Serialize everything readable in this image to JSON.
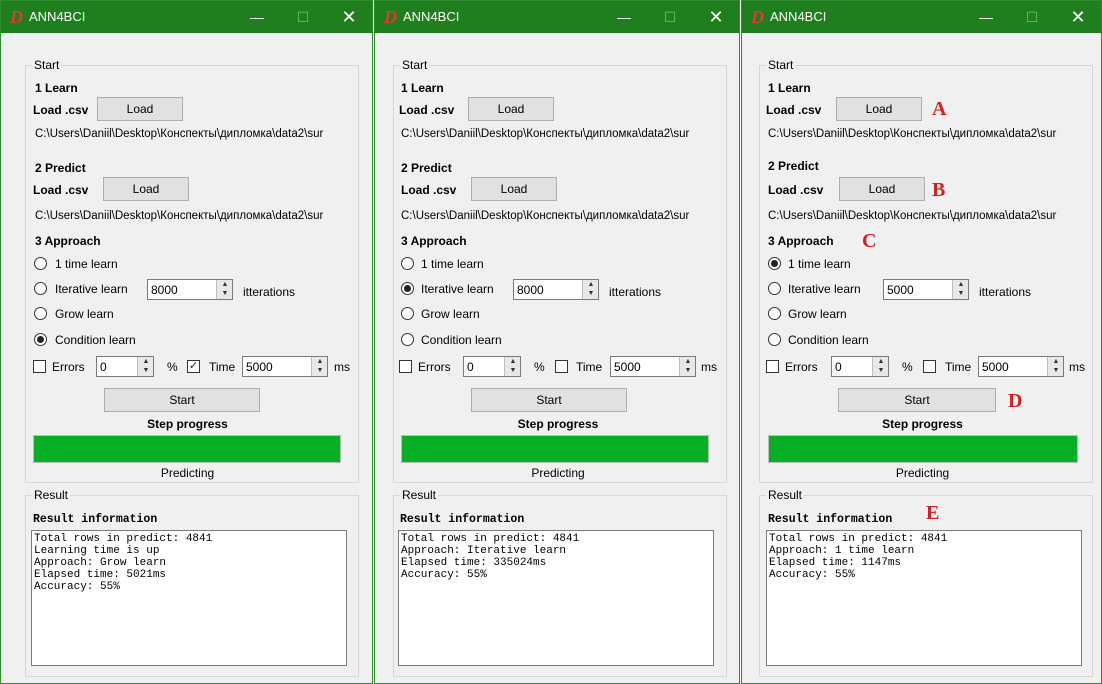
{
  "windows": [
    {
      "app_title": "ANN4BCI",
      "start_label": "Start",
      "learn_heading": "1 Learn",
      "learn_load_label": "Load .csv",
      "learn_load_button": "Load",
      "learn_path": "C:\\Users\\Daniil\\Desktop\\Конспекты\\дипломка\\data2\\sur",
      "predict_heading": "2 Predict",
      "predict_load_label": "Load .csv",
      "predict_load_button": "Load",
      "predict_path": "C:\\Users\\Daniil\\Desktop\\Конспекты\\дипломка\\data2\\sur",
      "approach_heading": "3 Approach",
      "radio_one_time": "1 time learn",
      "radio_iterative": "Iterative learn",
      "iterations_value": "8000",
      "iterations_label": "itterations",
      "radio_grow": "Grow learn",
      "radio_condition": "Condition learn",
      "selected_approach": "condition",
      "errors_label": "Errors",
      "errors_checked": false,
      "errors_value": "0",
      "percent_label": "%",
      "time_label": "Time",
      "time_checked": true,
      "time_value": "5000",
      "ms_label": "ms",
      "start_button": "Start",
      "step_progress_label": "Step progress",
      "progress_percent": 100,
      "progress_status": "Predicting",
      "result_label": "Result",
      "result_heading": "Result information",
      "result_lines": [
        "Total rows in predict: 4841",
        "Learning time is up",
        "Approach: Grow learn",
        "Elapsed time: 5021ms",
        "Accuracy: 55%"
      ]
    },
    {
      "app_title": "ANN4BCI",
      "start_label": "Start",
      "learn_heading": "1 Learn",
      "learn_load_label": "Load .csv",
      "learn_load_button": "Load",
      "learn_path": "C:\\Users\\Daniil\\Desktop\\Конспекты\\дипломка\\data2\\sur",
      "predict_heading": "2 Predict",
      "predict_load_label": "Load .csv",
      "predict_load_button": "Load",
      "predict_path": "C:\\Users\\Daniil\\Desktop\\Конспекты\\дипломка\\data2\\sur",
      "approach_heading": "3 Approach",
      "radio_one_time": "1 time learn",
      "radio_iterative": "Iterative learn",
      "iterations_value": "8000",
      "iterations_label": "itterations",
      "radio_grow": "Grow learn",
      "radio_condition": "Condition learn",
      "selected_approach": "iterative",
      "errors_label": "Errors",
      "errors_checked": false,
      "errors_value": "0",
      "percent_label": "%",
      "time_label": "Time",
      "time_checked": false,
      "time_value": "5000",
      "ms_label": "ms",
      "start_button": "Start",
      "step_progress_label": "Step progress",
      "progress_percent": 100,
      "progress_status": "Predicting",
      "result_label": "Result",
      "result_heading": "Result information",
      "result_lines": [
        "Total rows in predict: 4841",
        "Approach: Iterative learn",
        "Elapsed time: 335024ms",
        "Accuracy: 55%"
      ]
    },
    {
      "app_title": "ANN4BCI",
      "start_label": "Start",
      "learn_heading": "1 Learn",
      "learn_load_label": "Load .csv",
      "learn_load_button": "Load",
      "learn_path": "C:\\Users\\Daniil\\Desktop\\Конспекты\\дипломка\\data2\\sur",
      "predict_heading": "2 Predict",
      "predict_load_label": "Load .csv",
      "predict_load_button": "Load",
      "predict_path": "C:\\Users\\Daniil\\Desktop\\Конспекты\\дипломка\\data2\\sur",
      "approach_heading": "3 Approach",
      "radio_one_time": "1 time learn",
      "radio_iterative": "Iterative learn",
      "iterations_value": "5000",
      "iterations_label": "itterations",
      "radio_grow": "Grow learn",
      "radio_condition": "Condition learn",
      "selected_approach": "one_time",
      "errors_label": "Errors",
      "errors_checked": false,
      "errors_value": "0",
      "percent_label": "%",
      "time_label": "Time",
      "time_checked": false,
      "time_value": "5000",
      "ms_label": "ms",
      "start_button": "Start",
      "step_progress_label": "Step progress",
      "progress_percent": 100,
      "progress_status": "Predicting",
      "result_label": "Result",
      "result_heading": "Result information",
      "result_lines": [
        "Total rows in predict: 4841",
        "Approach: 1 time learn",
        "Elapsed time: 1147ms",
        "Accuracy: 55%"
      ]
    }
  ],
  "annotations": {
    "a": "A",
    "b": "B",
    "c": "C",
    "d": "D",
    "e": "E"
  },
  "colors": {
    "titlebar": "#1f7f1f",
    "progress_fill": "#06b025",
    "annotation": "#d62020",
    "logo": "#e53935"
  },
  "icons": {
    "logo": "D",
    "minimize": "minimize-icon",
    "maximize": "maximize-icon",
    "close": "close-icon"
  }
}
